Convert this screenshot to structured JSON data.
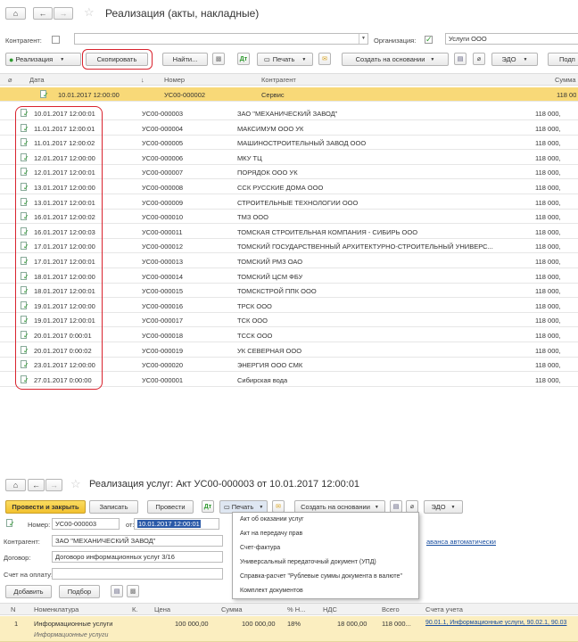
{
  "window1": {
    "title": "Реализация (акты, накладные)",
    "kontragent_label": "Контрагент:",
    "org_label": "Организация:",
    "org_value": "Услуги ООО",
    "org_checked": true,
    "toolbar": {
      "realization": "Реализация",
      "copy": "Скопировать",
      "find": "Найти...",
      "print": "Печать",
      "create_basis": "Создать на основании",
      "edo": "ЭДО",
      "more": "Подп"
    },
    "columns": {
      "date": "Дата",
      "number": "Номер",
      "counterparty": "Контрагент",
      "sum": "Сумма"
    },
    "selected_row": {
      "date": "10.01.2017 12:00:00",
      "number": "УС00-000002",
      "counterparty": "Сервис",
      "sum": "118 00"
    },
    "rows": [
      {
        "date": "10.01.2017 12:00:01",
        "number": "УС00-000003",
        "counterparty": "ЗАО \"МЕХАНИЧЕСКИЙ ЗАВОД\"",
        "sum": "118 000,"
      },
      {
        "date": "11.01.2017 12:00:01",
        "number": "УС00-000004",
        "counterparty": "МАКСИМУМ ООО УК",
        "sum": "118 000,"
      },
      {
        "date": "11.01.2017 12:00:02",
        "number": "УС00-000005",
        "counterparty": "МАШИНОСТРОИТЕЛЬНЫЙ ЗАВОД ООО",
        "sum": "118 000,"
      },
      {
        "date": "12.01.2017 12:00:00",
        "number": "УС00-000006",
        "counterparty": "МКУ ТЦ",
        "sum": "118 000,"
      },
      {
        "date": "12.01.2017 12:00:01",
        "number": "УС00-000007",
        "counterparty": "ПОРЯДОК ООО УК",
        "sum": "118 000,"
      },
      {
        "date": "13.01.2017 12:00:00",
        "number": "УС00-000008",
        "counterparty": "ССК РУССКИЕ ДОМА ООО",
        "sum": "118 000,"
      },
      {
        "date": "13.01.2017 12:00:01",
        "number": "УС00-000009",
        "counterparty": "СТРОИТЕЛЬНЫЕ ТЕХНОЛОГИИ ООО",
        "sum": "118 000,"
      },
      {
        "date": "16.01.2017 12:00:02",
        "number": "УС00-000010",
        "counterparty": "ТМЗ ООО",
        "sum": "118 000,"
      },
      {
        "date": "16.01.2017 12:00:03",
        "number": "УС00-000011",
        "counterparty": "ТОМСКАЯ СТРОИТЕЛЬНАЯ КОМПАНИЯ - СИБИРЬ ООО",
        "sum": "118 000,"
      },
      {
        "date": "17.01.2017 12:00:00",
        "number": "УС00-000012",
        "counterparty": "ТОМСКИЙ ГОСУДАРСТВЕННЫЙ АРХИТЕКТУРНО-СТРОИТЕЛЬНЫЙ УНИВЕРС...",
        "sum": "118 000,"
      },
      {
        "date": "17.01.2017 12:00:01",
        "number": "УС00-000013",
        "counterparty": "ТОМСКИЙ РМЗ ОАО",
        "sum": "118 000,"
      },
      {
        "date": "18.01.2017 12:00:00",
        "number": "УС00-000014",
        "counterparty": "ТОМСКИЙ ЦСМ ФБУ",
        "sum": "118 000,"
      },
      {
        "date": "18.01.2017 12:00:01",
        "number": "УС00-000015",
        "counterparty": "ТОМСКСТРОЙ ППК ООО",
        "sum": "118 000,"
      },
      {
        "date": "19.01.2017 12:00:00",
        "number": "УС00-000016",
        "counterparty": "ТРСК ООО",
        "sum": "118 000,"
      },
      {
        "date": "19.01.2017 12:00:01",
        "number": "УС00-000017",
        "counterparty": "ТСК ООО",
        "sum": "118 000,"
      },
      {
        "date": "20.01.2017 0:00:01",
        "number": "УС00-000018",
        "counterparty": "ТССК ООО",
        "sum": "118 000,"
      },
      {
        "date": "20.01.2017 0:00:02",
        "number": "УС00-000019",
        "counterparty": "УК СЕВЕРНАЯ ООО",
        "sum": "118 000,"
      },
      {
        "date": "23.01.2017 12:00:00",
        "number": "УС00-000020",
        "counterparty": "ЭНЕРГИЯ ООО СМК",
        "sum": "118 000,"
      },
      {
        "date": "27.01.2017 0:00:00",
        "number": "УС00-000001",
        "counterparty": "Сибирская вода",
        "sum": "118 000,"
      }
    ]
  },
  "window2": {
    "title": "Реализация услуг: Акт УС00-000003 от 10.01.2017 12:00:01",
    "toolbar": {
      "post_close": "Провести и закрыть",
      "save": "Записать",
      "post": "Провести",
      "print": "Печать",
      "create_basis": "Создать на основании",
      "edo": "ЭДО"
    },
    "number_label": "Номер:",
    "number_value": "УС00-000003",
    "from_label": "от:",
    "date_value": "10.01.2017 12:00:01",
    "kontragent_label": "Контрагент:",
    "kontragent_value": "ЗАО \"МЕХАНИЧЕСКИЙ ЗАВОД\"",
    "dogovor_label": "Договор:",
    "dogovor_value": "Договоро информационных услуг 3/16",
    "schet_label": "Счет на оплату:",
    "avans_link": "аванса автоматически",
    "add_btn": "Добавить",
    "select_btn": "Подбор",
    "print_menu": [
      "Акт об оказании услуг",
      "Акт на передачу прав",
      "Счет-фактура",
      "Универсальный передаточный документ (УПД)",
      "Справка-расчет \"Рублевые суммы документа в валюте\"",
      "Комплект документов"
    ],
    "columns": {
      "n": "N",
      "nom": "Номенклатура",
      "k": "К.",
      "price": "Цена",
      "sum": "Сумма",
      "vat_pct": "% Н...",
      "vat": "НДС",
      "total": "Всего",
      "account": "Счета учета"
    },
    "line": {
      "n": "1",
      "nom": "Информационные услуги",
      "nom2": "Информационные услуги",
      "price": "100 000,00",
      "sum": "100 000,00",
      "vat_pct": "18%",
      "vat": "18 000,00",
      "total": "118 000...",
      "account": "90.01.1, Информационные услуги, 90.02.1, 90.03"
    }
  },
  "colors": {
    "selected_row": "#f8d978",
    "highlight_oval": "#d9232e",
    "post_close_button": "#f7cf3b",
    "link": "#1a4fa0"
  }
}
